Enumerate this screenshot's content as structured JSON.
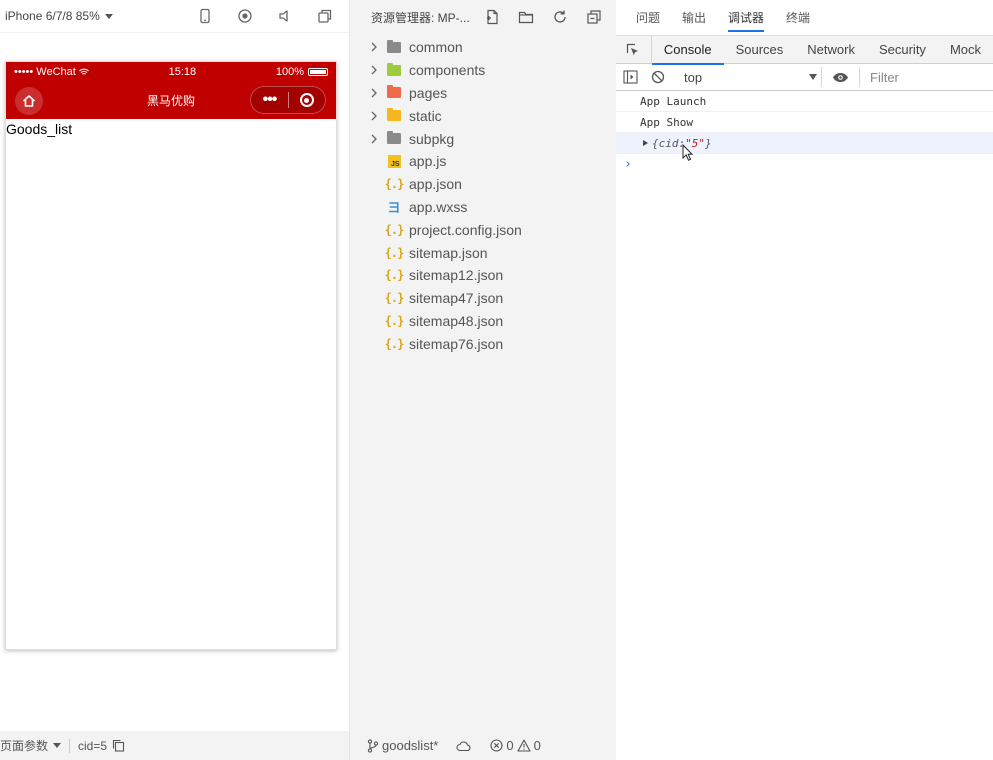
{
  "simulator": {
    "device_label": "iPhone 6/7/8 85%",
    "status_bar": {
      "carrier": "••••• WeChat",
      "time": "15:18",
      "battery": "100%"
    },
    "navbar_title": "黑马优购",
    "capsule_more": "•••",
    "page_text": "Goods_list",
    "footer": {
      "page_params_label": "页面参数",
      "query": "cid=5"
    },
    "accent_color": "#c00000"
  },
  "explorer": {
    "title": "资源管理器: MP-...",
    "folders": [
      {
        "name": "common",
        "icon": "folder-gray",
        "color": "#8a8a8a"
      },
      {
        "name": "components",
        "icon": "folder-components",
        "color": "#9ccc3d"
      },
      {
        "name": "pages",
        "icon": "folder-pages",
        "color": "#f06b4a"
      },
      {
        "name": "static",
        "icon": "folder-static",
        "color": "#f5b91f"
      },
      {
        "name": "subpkg",
        "icon": "folder-gray",
        "color": "#8a8a8a"
      }
    ],
    "files": [
      {
        "name": "app.js",
        "type": "js"
      },
      {
        "name": "app.json",
        "type": "json"
      },
      {
        "name": "app.wxss",
        "type": "css"
      },
      {
        "name": "project.config.json",
        "type": "json"
      },
      {
        "name": "sitemap.json",
        "type": "json"
      },
      {
        "name": "sitemap12.json",
        "type": "json"
      },
      {
        "name": "sitemap47.json",
        "type": "json"
      },
      {
        "name": "sitemap48.json",
        "type": "json"
      },
      {
        "name": "sitemap76.json",
        "type": "json"
      }
    ],
    "footer": {
      "branch": "goodslist*",
      "errors": "0",
      "warnings": "0"
    }
  },
  "devtools": {
    "top_tabs": [
      "问题",
      "输出",
      "调试器",
      "终端"
    ],
    "active_top_tab": "调试器",
    "panel_tabs": [
      "Console",
      "Sources",
      "Network",
      "Security",
      "Mock"
    ],
    "active_panel_tab": "Console",
    "context": "top",
    "filter_placeholder": "Filter",
    "console": {
      "lines": [
        "App  Launch",
        "App  Show"
      ],
      "object_prefix": "{cid: ",
      "object_value": "\"5\"",
      "object_suffix": "}"
    },
    "prompt": "›"
  }
}
